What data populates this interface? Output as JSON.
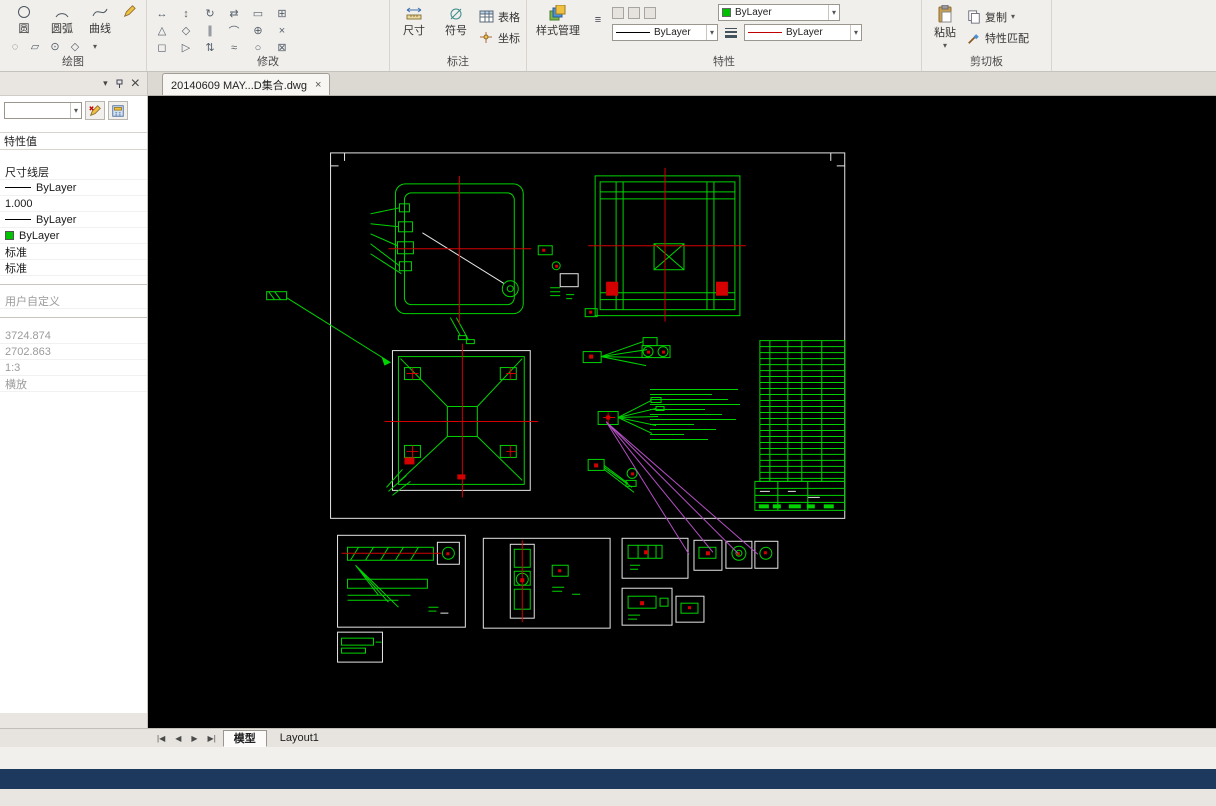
{
  "colors": {
    "canvas_bg": "#000000",
    "cad_green": "#00d400",
    "cad_red": "#d40000",
    "cad_white": "#e8e8e8",
    "cad_magenta": "#b44fc4",
    "palette_swatch_green": "#00c400",
    "command_bar_blue": "#1d3a5e"
  },
  "icons": {
    "dropdown": "▾",
    "close": "×",
    "overflow": "≡",
    "nav": [
      "|◀",
      "◀",
      "▶",
      "▶|"
    ],
    "draw_extra": [
      "◌",
      "▱",
      "⊙",
      "◇"
    ],
    "modify_tools": [
      "↔",
      "↕",
      "↻",
      "⇄",
      "▭",
      "⊞",
      "△",
      "◇",
      "∥",
      "⌒",
      "⊕",
      "×",
      "◻",
      "▷",
      "⇅",
      "≈",
      "○",
      "⊠"
    ]
  },
  "ribbon": {
    "panels": [
      {
        "label": "绘图"
      },
      {
        "label": "修改"
      },
      {
        "label": "标注"
      },
      {
        "label": "特性"
      },
      {
        "label": "剪切板"
      }
    ],
    "draw": {
      "circle": "圆",
      "arc": "圆弧",
      "curve": "曲线"
    },
    "annotate": {
      "dimension": "尺寸",
      "symbol": "符号",
      "table": "表格",
      "coordinate": "坐标"
    },
    "properties": {
      "style_manager": "样式管理",
      "color_value": "ByLayer",
      "linetype_value": "ByLayer",
      "linetype2_value": "ByLayer"
    },
    "clipboard": {
      "paste": "粘贴",
      "copy": "复制",
      "match_properties": "特性匹配"
    }
  },
  "document_tabs": {
    "active": "20140609 MAY...D集合.dwg"
  },
  "palette": {
    "header": "特性值",
    "rows": [
      {
        "label": "尺寸线层"
      },
      {
        "label": "ByLayer"
      },
      {
        "label": "1.000"
      },
      {
        "label": "ByLayer"
      },
      {
        "label": "ByLayer"
      },
      {
        "label": "标准"
      },
      {
        "label": "标准"
      },
      {
        "label": "用户自定义"
      },
      {
        "label": "3724.874"
      },
      {
        "label": "2702.863"
      },
      {
        "label": "1:3"
      },
      {
        "label": "横放"
      }
    ]
  },
  "layout_bar": {
    "model_tab": "模型",
    "layout1_tab": "Layout1"
  }
}
